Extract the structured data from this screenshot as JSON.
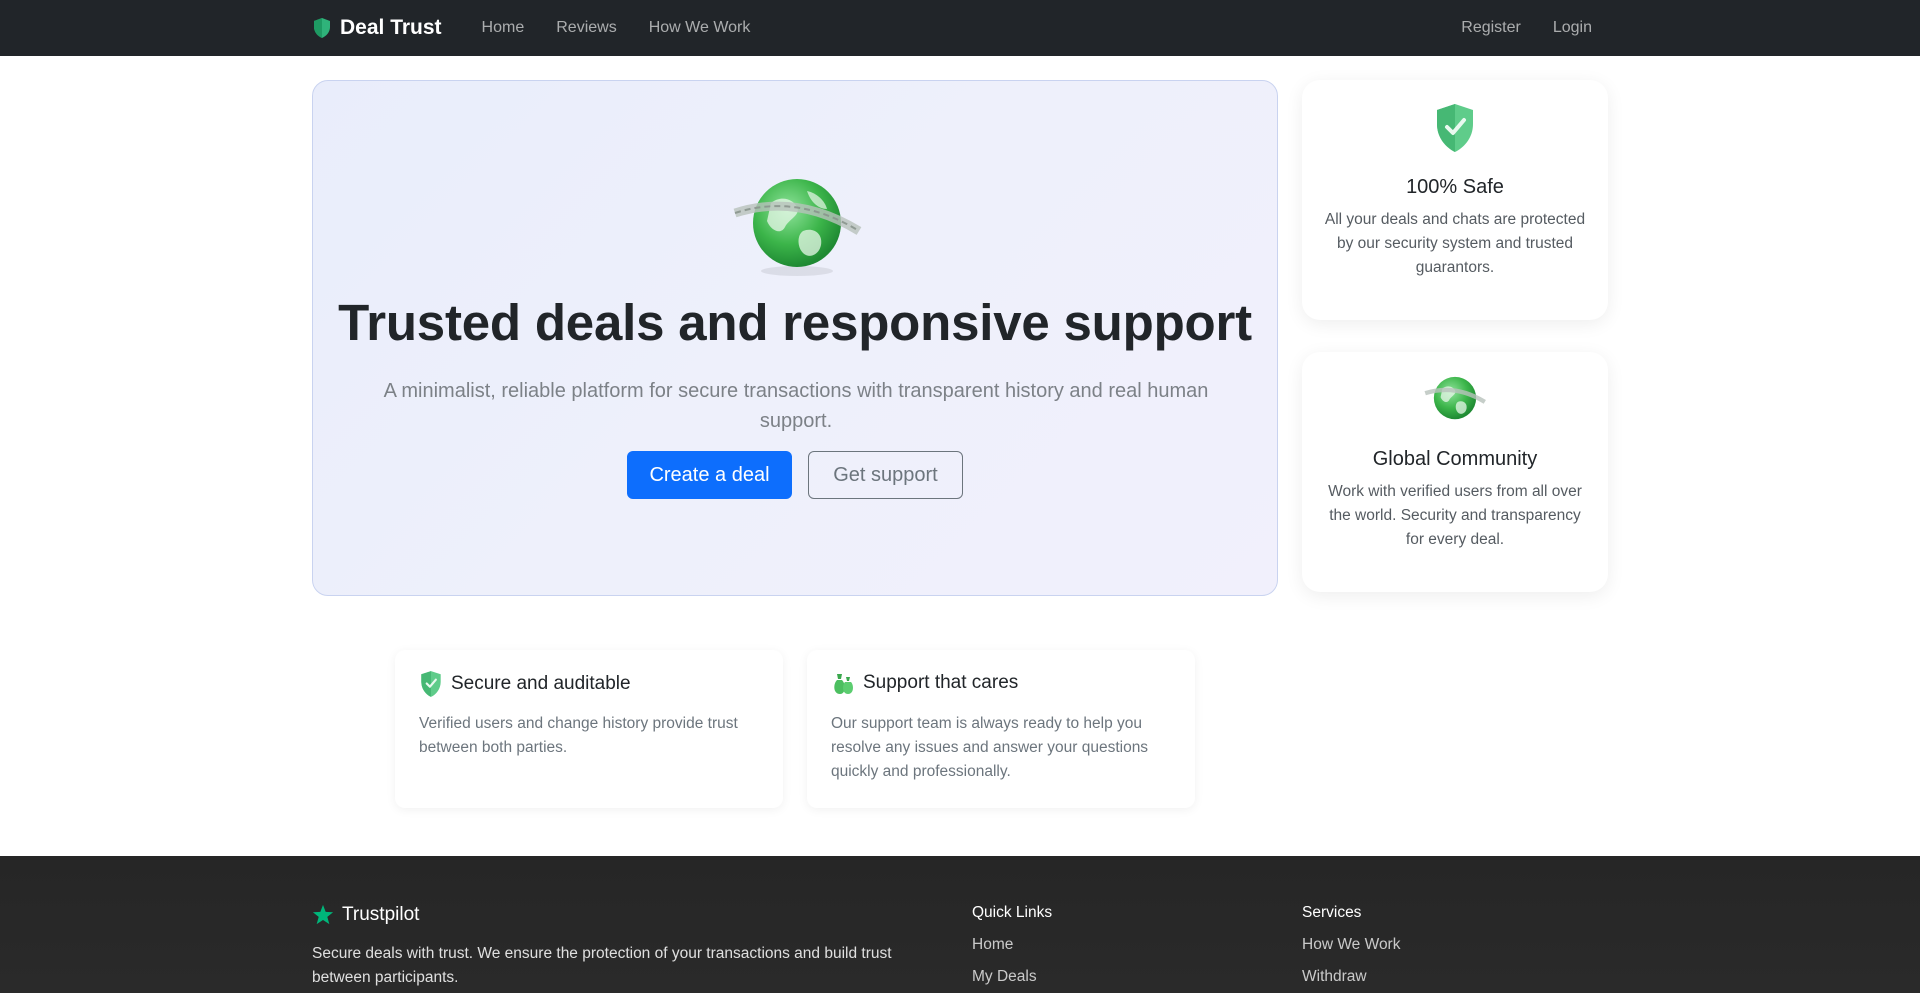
{
  "nav": {
    "brand": "Deal Trust",
    "links": [
      "Home",
      "Reviews",
      "How We Work"
    ],
    "right_links": [
      "Register",
      "Login"
    ],
    "brand_icon": "shield-icon"
  },
  "hero": {
    "title": "Trusted deals and responsive support",
    "subtitle": "A minimalist, reliable platform for secure transactions with transparent history and real human support.",
    "primary_button": "Create a deal",
    "secondary_button": "Get support",
    "icon": "globe-icon"
  },
  "side_cards": [
    {
      "icon": "shield-check-icon",
      "title": "100% Safe",
      "text": "All your deals and chats are protected by our security system and trusted guarantors."
    },
    {
      "icon": "globe-icon",
      "title": "Global Community",
      "text": "Work with verified users from all over the world. Security and transparency for every deal."
    }
  ],
  "features": [
    {
      "icon": "shield-check-icon",
      "title": "Secure and auditable",
      "text": "Verified users and change history provide trust between both parties."
    },
    {
      "icon": "money-bag-icon",
      "title": "Support that cares",
      "text": "Our support team is always ready to help you resolve any issues and answer your questions quickly and professionally."
    }
  ],
  "footer": {
    "brand": "Trustpilot",
    "brand_icon": "star-icon",
    "description": "Secure deals with trust. We ensure the protection of your transactions and build trust between participants.",
    "quick_links": {
      "title": "Quick Links",
      "items": [
        "Home",
        "My Deals"
      ]
    },
    "services": {
      "title": "Services",
      "items": [
        "How We Work",
        "Withdraw"
      ]
    }
  },
  "colors": {
    "navbar": "#212529",
    "primary": "#0d6efd",
    "accent_green": "#3db86b",
    "footer": "#262626"
  }
}
